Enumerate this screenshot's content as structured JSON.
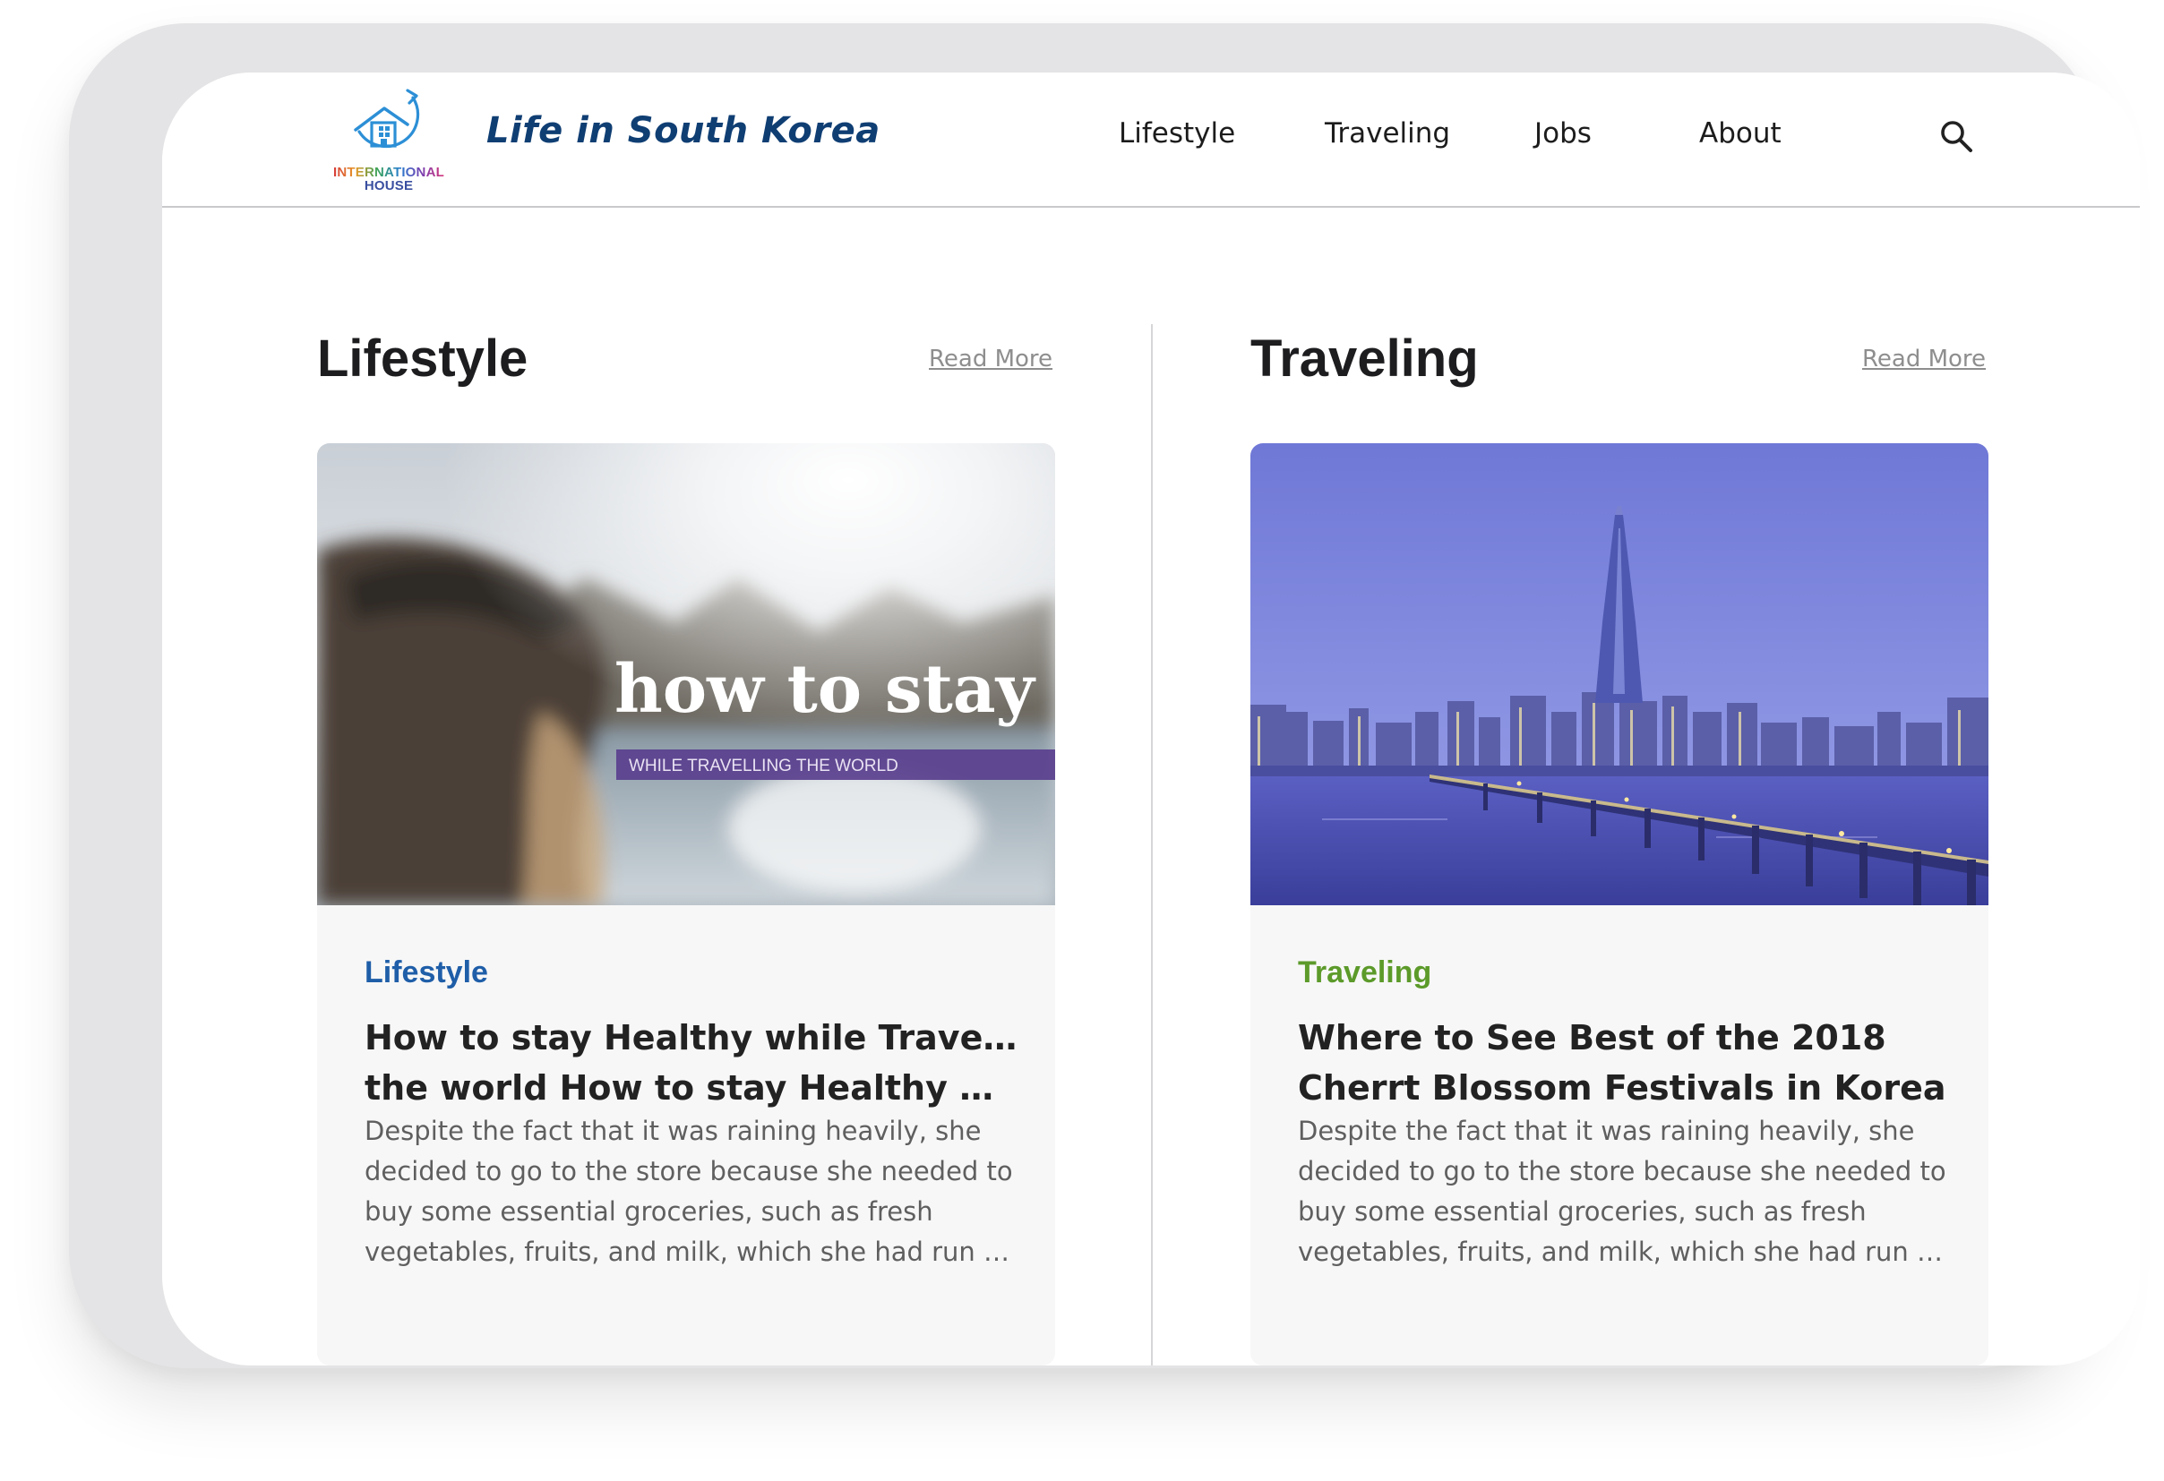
{
  "brand": {
    "logo_line1": "INTERNATIONAL",
    "logo_line2": "HOUSE",
    "site_title": "Life in South Korea"
  },
  "nav": {
    "items": [
      {
        "label": "Lifestyle"
      },
      {
        "label": "Traveling"
      },
      {
        "label": "Jobs"
      },
      {
        "label": "About"
      }
    ],
    "search_icon": "search-icon"
  },
  "sections": [
    {
      "title": "Lifestyle",
      "read_more": "Read More",
      "card": {
        "image_headline": "how to stay he",
        "image_subline": "WHILE TRAVELLING THE WORLD",
        "category": "Lifestyle",
        "category_color": "#1f5ea8",
        "title_lines": [
          "How to stay Healthy while Traveling",
          "the world How to stay Healthy whi..."
        ],
        "excerpt_lines": [
          "Despite the fact that it was raining heavily, she",
          "decided to go to the store because she needed to",
          "buy some essential groceries, such as fresh",
          "vegetables, fruits, and milk, which she had run ou..."
        ]
      }
    },
    {
      "title": "Traveling",
      "read_more": "Read More",
      "card": {
        "category": "Traveling",
        "category_color": "#5c9a2a",
        "title_lines": [
          "Where to See Best of the 2018",
          "Cherrt Blossom Festivals in Korea"
        ],
        "excerpt_lines": [
          "Despite the fact that it was raining heavily, she",
          "decided to go to the store because she needed to",
          "buy some essential groceries, such as fresh",
          "vegetables, fruits, and milk, which she had run ou..."
        ]
      }
    }
  ]
}
